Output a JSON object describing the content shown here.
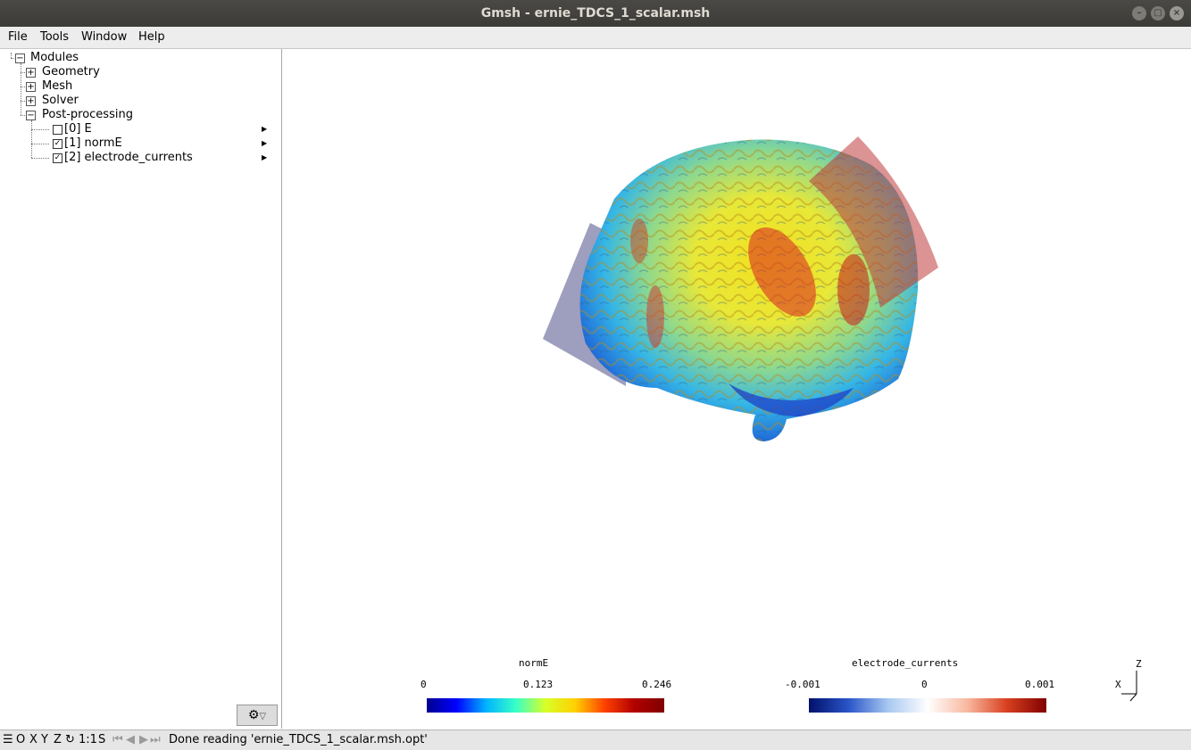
{
  "window": {
    "title": "Gmsh - ernie_TDCS_1_scalar.msh",
    "controls": [
      "minimize-icon",
      "maximize-icon",
      "close-icon"
    ]
  },
  "menu": {
    "file": "File",
    "tools": "Tools",
    "window": "Window",
    "help": "Help"
  },
  "tree": {
    "root": "Modules",
    "geometry": "Geometry",
    "mesh": "Mesh",
    "solver": "Solver",
    "postprocessing": "Post-processing",
    "views": [
      {
        "label": "[0] E",
        "checked": false
      },
      {
        "label": "[1] normE",
        "checked": true
      },
      {
        "label": "[2] electrode_currents",
        "checked": true
      }
    ]
  },
  "colorbars": {
    "norme": {
      "title": "normE",
      "min": "0",
      "mid": "0.123",
      "max": "0.246"
    },
    "currents": {
      "title": "electrode_currents",
      "min": "-0.001",
      "mid": "0",
      "max": "0.001"
    }
  },
  "axes": {
    "z": "Z",
    "x": "X"
  },
  "statusbar": {
    "o": "O",
    "x": "X",
    "y": "Y",
    "z": "Z",
    "scale": "1:1",
    "s": "S",
    "message": "Done reading 'ernie_TDCS_1_scalar.msh.opt'"
  }
}
